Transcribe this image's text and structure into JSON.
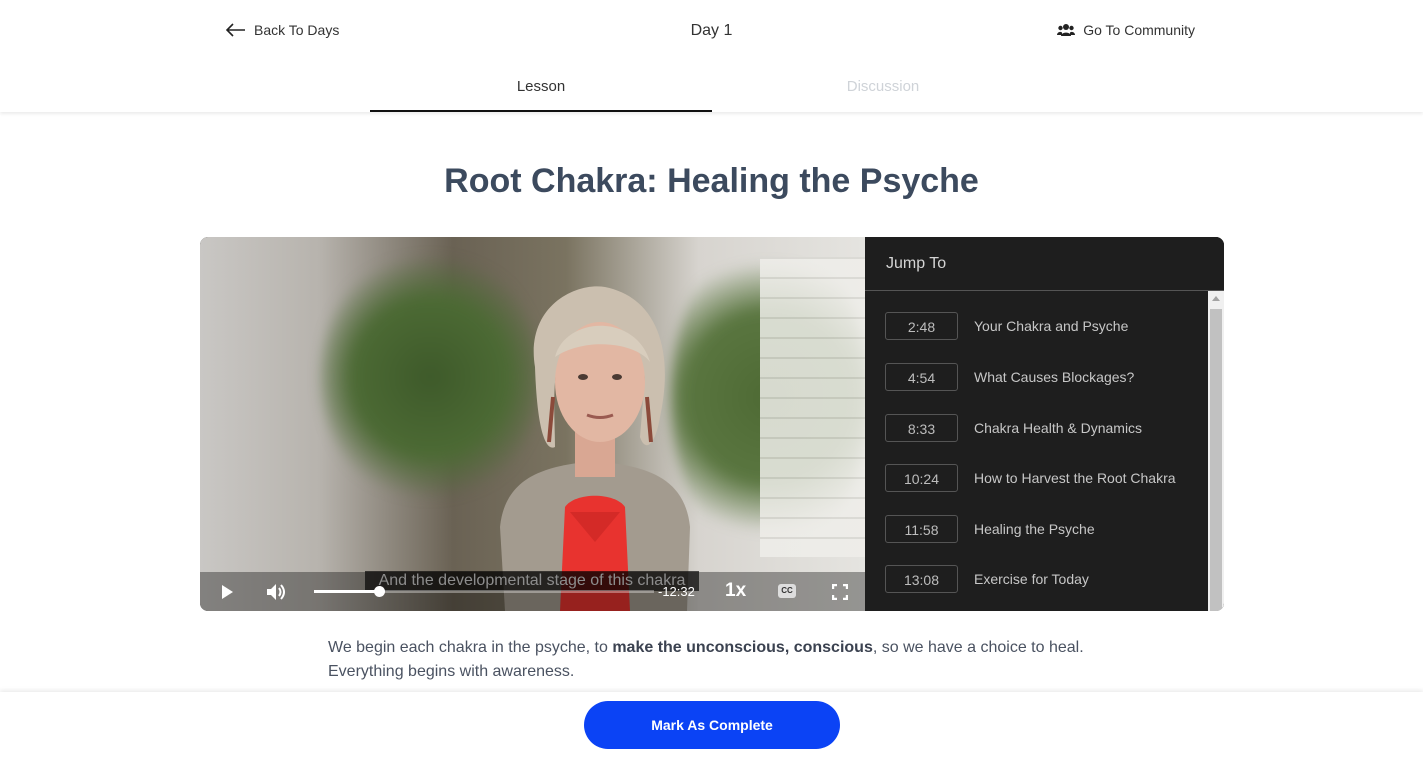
{
  "header": {
    "back_label": "Back To Days",
    "day_title": "Day 1",
    "community_label": "Go To Community"
  },
  "tabs": [
    {
      "label": "Lesson",
      "active": true
    },
    {
      "label": "Discussion",
      "active": false
    }
  ],
  "lesson": {
    "title": "Root Chakra: Healing the Psyche"
  },
  "video": {
    "caption": "And the developmental stage of this chakra",
    "progress": 0.19,
    "time_remaining": "-12:32",
    "speed": "1x",
    "cc_label": "CC"
  },
  "jump_to": {
    "title": "Jump To",
    "items": [
      {
        "time": "2:48",
        "label": "Your Chakra and Psyche"
      },
      {
        "time": "4:54",
        "label": "What Causes Blockages?"
      },
      {
        "time": "8:33",
        "label": "Chakra Health & Dynamics"
      },
      {
        "time": "10:24",
        "label": "How to Harvest the Root Chakra"
      },
      {
        "time": "11:58",
        "label": "Healing the Psyche"
      },
      {
        "time": "13:08",
        "label": "Exercise for Today"
      }
    ]
  },
  "description": {
    "part1": "We begin each chakra in the psyche, to ",
    "bold": "make the unconscious, conscious",
    "part2": ", so we have a choice to heal. Everything begins with awareness."
  },
  "footer": {
    "complete_label": "Mark As Complete"
  },
  "colors": {
    "primary_button": "#0b43f5",
    "title": "#3c4a5e",
    "panel_bg": "#1e1e1e"
  }
}
